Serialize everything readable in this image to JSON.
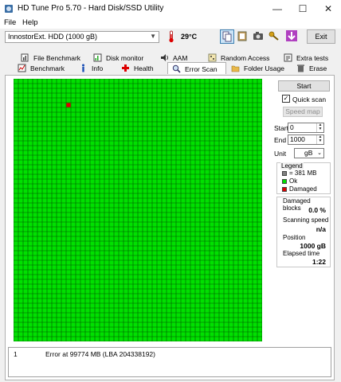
{
  "window": {
    "title": "HD Tune Pro 5.70 - Hard Disk/SSD Utility",
    "minimize": "—",
    "maximize": "☐",
    "close": "✕"
  },
  "menu": [
    "File",
    "Help"
  ],
  "toolbar": {
    "drive": "InnostorExt. HDD (1000 gB)",
    "temperature": "29°C",
    "exit": "Exit"
  },
  "tabs_row1": [
    "File Benchmark",
    "Disk monitor",
    "AAM",
    "Random Access",
    "Extra tests"
  ],
  "tabs_row2": [
    "Benchmark",
    "Info",
    "Health",
    "Error Scan",
    "Folder Usage",
    "Erase"
  ],
  "active_tab": "Error Scan",
  "scan": {
    "start_label": "Start",
    "quick_scan_label": "Quick scan",
    "quick_scan_checked": true,
    "speed_map_label": "Speed map",
    "start_field_label": "Start",
    "start_value": "0",
    "end_field_label": "End",
    "end_value": "1000",
    "unit_label": "Unit",
    "unit_value": "gB"
  },
  "legend": {
    "title": "Legend",
    "block": "= 381 MB",
    "ok": "Ok",
    "damaged": "Damaged"
  },
  "stats": {
    "damaged_blocks_label": "Damaged blocks",
    "damaged_blocks_value": "0.0 %",
    "scanning_speed_label": "Scanning speed",
    "scanning_speed_value": "n/a",
    "position_label": "Position",
    "position_value": "1000 gB",
    "elapsed_label": "Elapsed time",
    "elapsed_value": "1:22"
  },
  "log": [
    {
      "num": "1",
      "message": "Error at 99774 MB (LBA 204338192)"
    }
  ],
  "grid": {
    "cols": 52,
    "rows": 55,
    "damaged_cells": [
      {
        "row": 5,
        "col": 11
      }
    ]
  },
  "colors": {
    "ok": "#00e000",
    "damaged": "#e00000",
    "grid_line": "#005a00",
    "gray_block": "#808080"
  }
}
